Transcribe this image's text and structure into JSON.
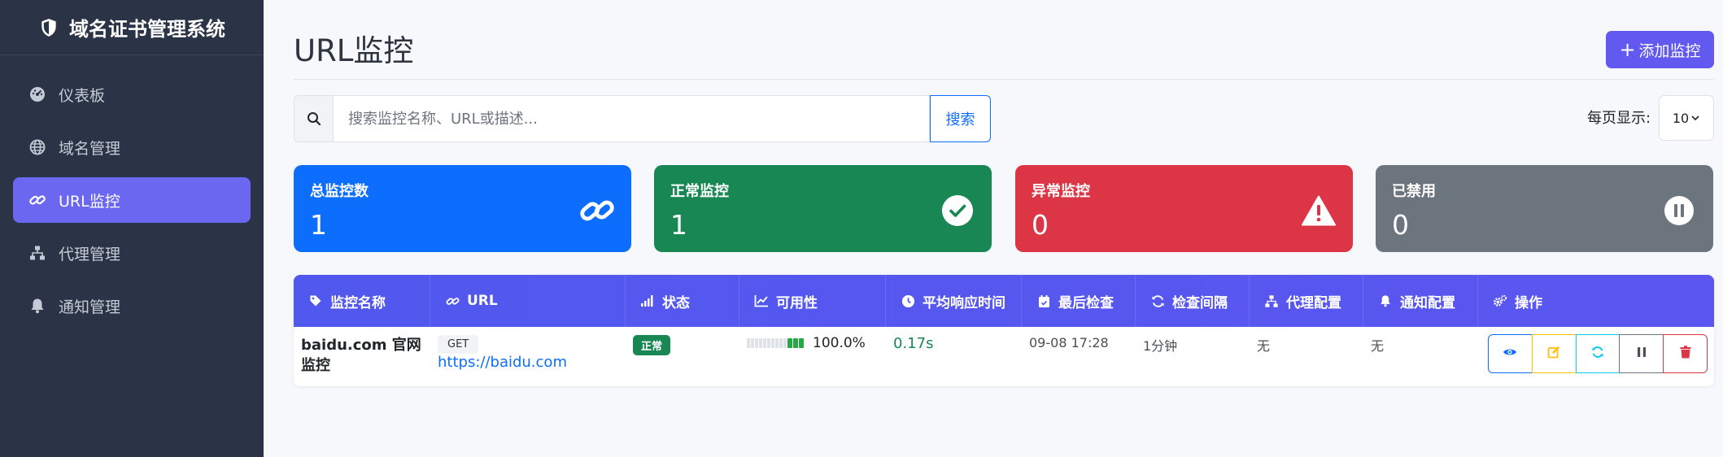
{
  "app": {
    "title": "域名证书管理系统"
  },
  "sidebar": {
    "items": [
      {
        "label": "仪表板",
        "icon": "dashboard-icon"
      },
      {
        "label": "域名管理",
        "icon": "globe-icon"
      },
      {
        "label": "URL监控",
        "icon": "link-icon",
        "active": true
      },
      {
        "label": "代理管理",
        "icon": "network-icon"
      },
      {
        "label": "通知管理",
        "icon": "bell-icon"
      }
    ]
  },
  "header": {
    "title": "URL监控",
    "add_label": "添加监控"
  },
  "search": {
    "placeholder": "搜索监控名称、URL或描述...",
    "button": "搜索"
  },
  "pagination": {
    "label": "每页显示:",
    "value": "10"
  },
  "stats": [
    {
      "label": "总监控数",
      "value": "1",
      "color": "#0d6efd"
    },
    {
      "label": "正常监控",
      "value": "1",
      "color": "#198754"
    },
    {
      "label": "异常监控",
      "value": "0",
      "color": "#dc3545"
    },
    {
      "label": "已禁用",
      "value": "0",
      "color": "#6c757d"
    }
  ],
  "table": {
    "columns": [
      "监控名称",
      "URL",
      "状态",
      "可用性",
      "平均响应时间",
      "最后检查",
      "检查间隔",
      "代理配置",
      "通知配置",
      "操作"
    ],
    "rows": [
      {
        "name_line1": "baidu.com 官网",
        "name_line2": "监控",
        "method": "GET",
        "url": "https://baidu.com",
        "status": "正常",
        "availability": "100.0%",
        "response": "0.17s",
        "last_check": "09-08 17:28",
        "interval": "1分钟",
        "proxy": "无",
        "notify": "无"
      }
    ]
  }
}
